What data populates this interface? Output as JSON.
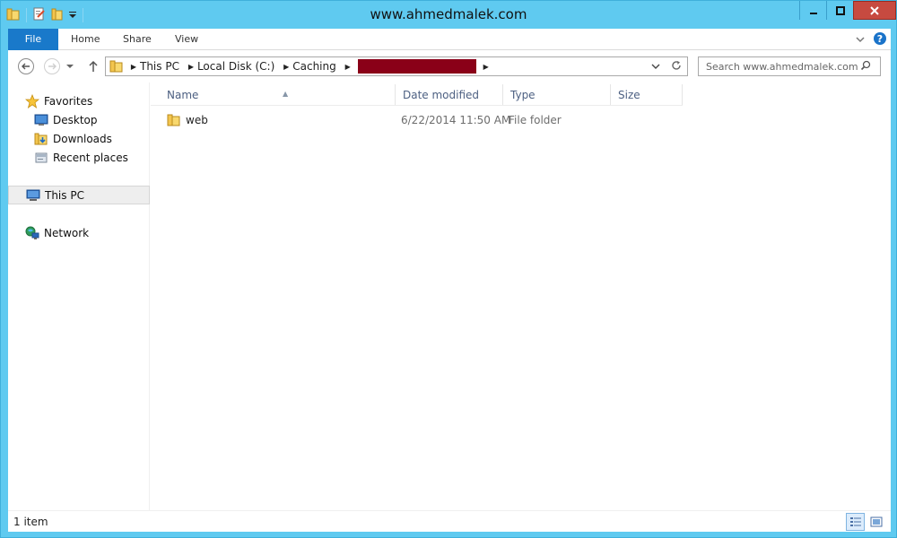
{
  "window": {
    "title": "www.ahmedmalek.com",
    "colors": {
      "frame": "#5fcaf0",
      "file_tab": "#1979ca",
      "close": "#c74a40",
      "redaction": "#8a0018"
    }
  },
  "ribbon": {
    "tabs": [
      "File",
      "Home",
      "Share",
      "View"
    ]
  },
  "address": {
    "crumbs": [
      "This PC",
      "Local Disk (C:)",
      "Caching"
    ]
  },
  "search": {
    "placeholder": "Search www.ahmedmalek.com"
  },
  "navpane": {
    "favorites": "Favorites",
    "desktop": "Desktop",
    "downloads": "Downloads",
    "recent": "Recent places",
    "thispc": "This PC",
    "network": "Network"
  },
  "filelist": {
    "columns": [
      "Name",
      "Date modified",
      "Type",
      "Size"
    ],
    "rows": [
      {
        "name": "web",
        "date": "6/22/2014 11:50 AM",
        "type": "File folder",
        "size": ""
      }
    ]
  },
  "status": {
    "count": "1 item"
  }
}
